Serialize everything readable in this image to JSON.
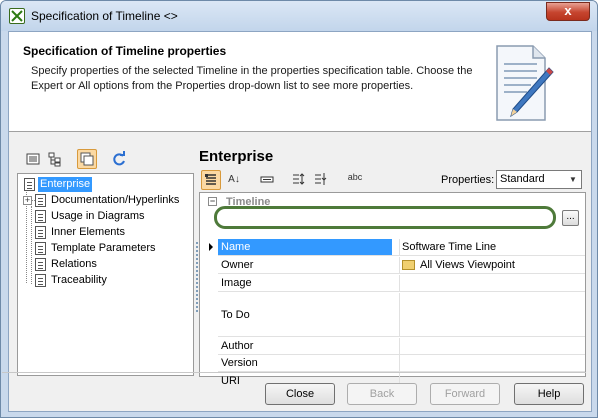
{
  "window": {
    "title": "Specification of Timeline <>",
    "close_label": "x"
  },
  "header": {
    "title": "Specification of Timeline properties",
    "description": "Specify properties of the selected Timeline in the properties specification table. Choose the Expert or All options from the Properties drop-down list to see more properties."
  },
  "tree": {
    "items": [
      {
        "label": "Enterprise"
      },
      {
        "label": "Documentation/Hyperlinks"
      },
      {
        "label": "Usage in Diagrams"
      },
      {
        "label": "Inner Elements"
      },
      {
        "label": "Template Parameters"
      },
      {
        "label": "Relations"
      },
      {
        "label": "Traceability"
      }
    ]
  },
  "panel": {
    "title": "Enterprise",
    "properties_label": "Properties:",
    "properties_value": "Standard",
    "sort_az_label": "A↓",
    "abc_label": "abc"
  },
  "grid": {
    "group": "Timeline",
    "rows": [
      {
        "name": "Name",
        "value": "Software Time Line"
      },
      {
        "name": "Owner",
        "value": "All Views Viewpoint"
      },
      {
        "name": "Image",
        "value": ""
      },
      {
        "name": "To Do",
        "value": ""
      },
      {
        "name": "Author",
        "value": ""
      },
      {
        "name": "Version",
        "value": ""
      },
      {
        "name": "URI",
        "value": ""
      }
    ],
    "ellipsis_label": "..."
  },
  "buttons": {
    "close": "Close",
    "back": "Back",
    "forward": "Forward",
    "help": "Help"
  },
  "icons": {
    "app": "magicdraw-app-icon",
    "header_doc": "document-pencil-icon",
    "list_view": "list-view-icon",
    "tree_view": "tree-view-icon",
    "copy": "copy-icon",
    "refresh": "refresh-icon"
  },
  "colors": {
    "selection": "#3399ff",
    "highlight_ring": "#4e7a3a",
    "active_toolbar": "#fbd9a3"
  }
}
